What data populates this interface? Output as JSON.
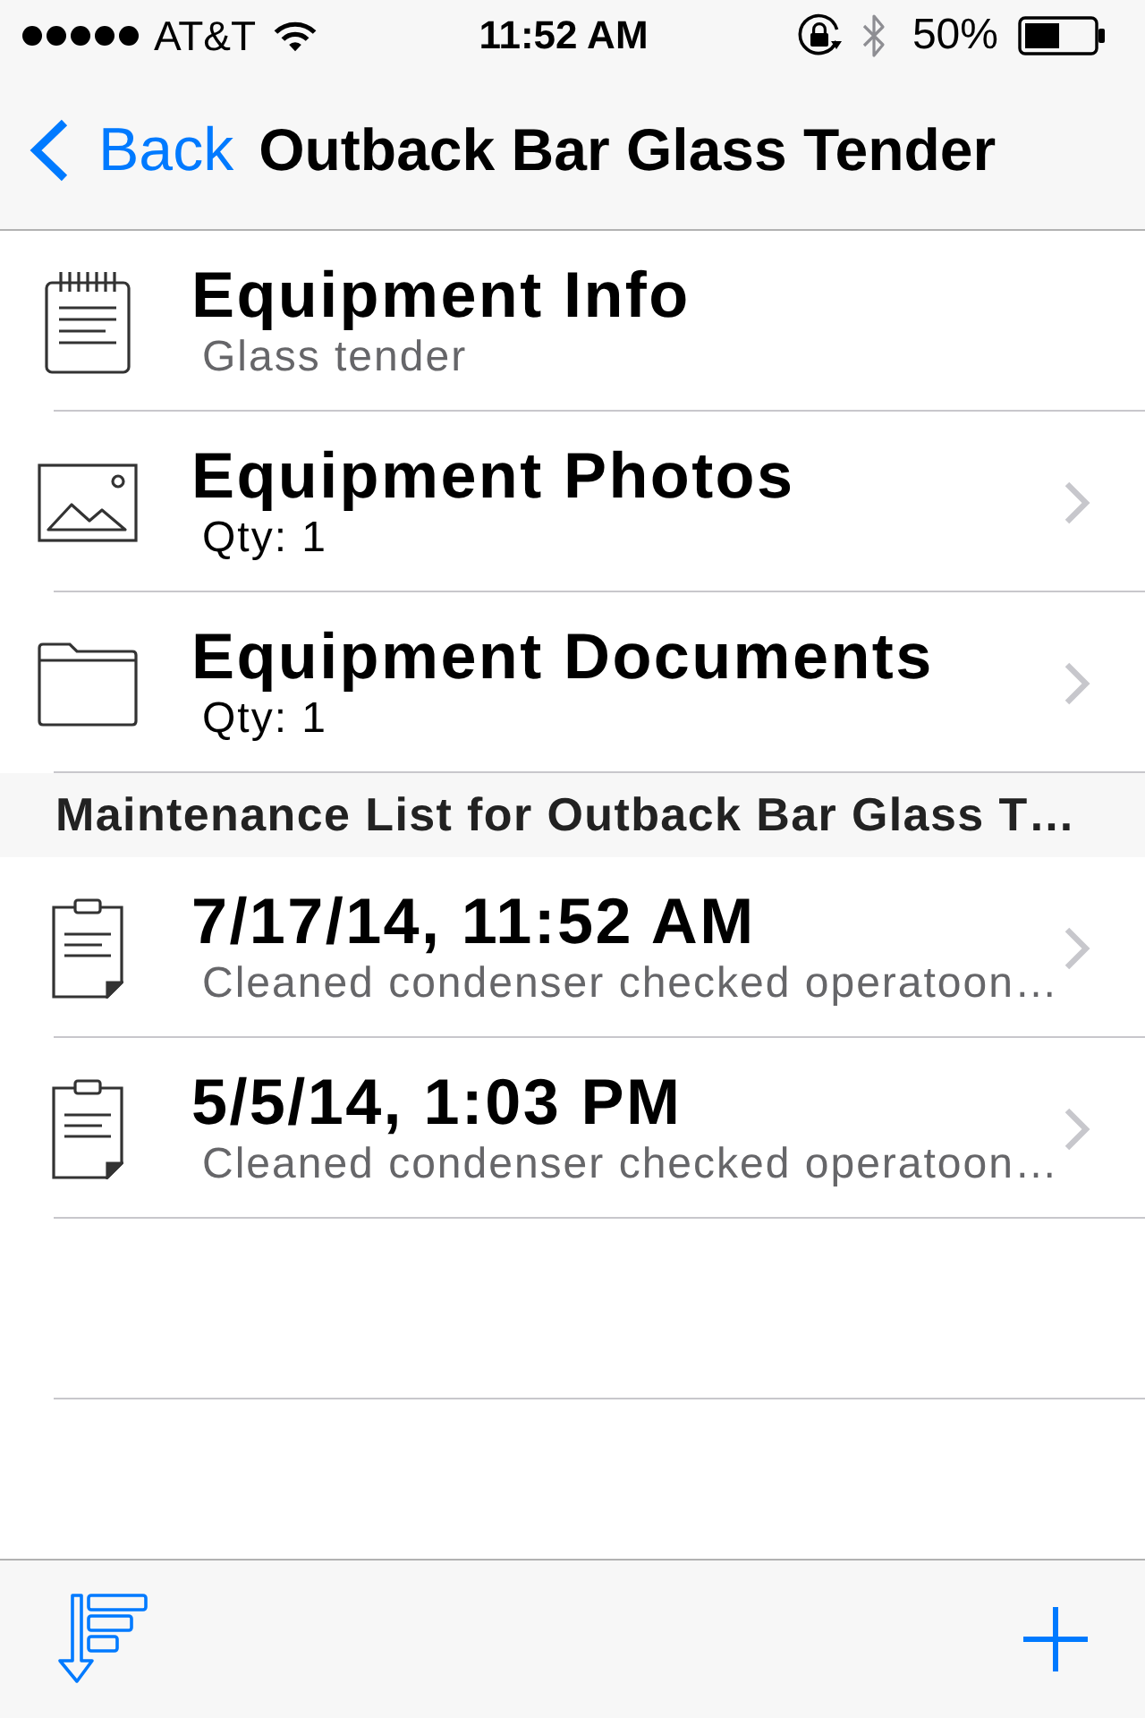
{
  "status_bar": {
    "carrier": "AT&T",
    "time": "11:52 AM",
    "battery_percent": "50%"
  },
  "nav_bar": {
    "back_label": "Back",
    "title": "Outback Bar Glass Tender"
  },
  "equipment_rows": [
    {
      "kind": "notes",
      "title": "Equipment Info",
      "subtitle": "Glass tender",
      "subtitle_muted": true,
      "disclosure": false
    },
    {
      "kind": "photos",
      "title": "Equipment Photos",
      "subtitle": "Qty: 1",
      "subtitle_muted": false,
      "disclosure": true
    },
    {
      "kind": "documents",
      "title": "Equipment Documents",
      "subtitle": "Qty: 1",
      "subtitle_muted": false,
      "disclosure": true
    }
  ],
  "maintenance": {
    "header": "Maintenance List for Outback Bar Glass T…",
    "records": [
      {
        "title": "7/17/14, 11:52 AM",
        "subtitle": "Cleaned condenser checked operatoon…",
        "subtitle_muted": true,
        "disclosure": true
      },
      {
        "title": "5/5/14, 1:03 PM",
        "subtitle": "Cleaned condenser checked operatoon…",
        "subtitle_muted": true,
        "disclosure": true
      }
    ]
  }
}
